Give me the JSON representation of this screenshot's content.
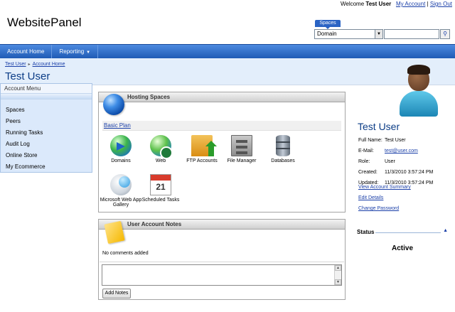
{
  "topbar": {
    "welcome": "Welcome",
    "user": "Test User",
    "my_account": "My Account",
    "separator": "|",
    "sign_out": "Sign Out"
  },
  "brand": "WebsitePanel",
  "search": {
    "tab_label": "Spaces",
    "select_value": "Domain",
    "input_value": "",
    "button_icon": "search-icon"
  },
  "nav": {
    "items": [
      {
        "label": "Account Home"
      },
      {
        "label": "Reporting",
        "has_dropdown": true
      }
    ]
  },
  "breadcrumb": {
    "items": [
      "Test User",
      "Account Home"
    ]
  },
  "page_title": "Test User",
  "left_menu": {
    "title": "Account Menu",
    "items": [
      "Spaces",
      "Peers",
      "Running Tasks",
      "Audit Log",
      "Online Store",
      "My Ecommerce"
    ]
  },
  "hosting": {
    "title": "Hosting Spaces",
    "plan": "Basic Plan",
    "tiles": [
      {
        "label": "Domains",
        "icon": "domains-icon"
      },
      {
        "label": "Web",
        "icon": "web-globe-icon"
      },
      {
        "label": "FTP Accounts",
        "icon": "ftp-folder-icon"
      },
      {
        "label": "File Manager",
        "icon": "file-cabinet-icon"
      },
      {
        "label": "Databases",
        "icon": "database-icon"
      },
      {
        "label": "Microsoft Web App Gallery",
        "icon": "web-app-gallery-icon"
      },
      {
        "label": "Scheduled Tasks",
        "icon": "calendar-icon"
      }
    ]
  },
  "notes": {
    "title": "User Account Notes",
    "empty_text": "No comments added",
    "textarea_value": "",
    "add_button": "Add Notes"
  },
  "profile": {
    "name": "Test User",
    "fields": [
      {
        "key": "Full Name:",
        "value": "Test User",
        "link": false
      },
      {
        "key": "E-Mail:",
        "value": "test@user.com",
        "link": true
      },
      {
        "key": "Role:",
        "value": "User",
        "link": false
      },
      {
        "key": "Created:",
        "value": "11/3/2010 3:57:24 PM",
        "link": false
      },
      {
        "key": "Updated:",
        "value": "11/3/2010 3:57:24 PM",
        "link": false
      }
    ],
    "links": [
      "View Account Summary",
      "Edit Details",
      "Change Password"
    ]
  },
  "status": {
    "title": "Status",
    "value": "Active"
  },
  "colors": {
    "nav": "#2a63c4",
    "title_blue": "#0b3c86",
    "link": "#1a3fa8",
    "menu_bg": "#dbe9fb"
  }
}
